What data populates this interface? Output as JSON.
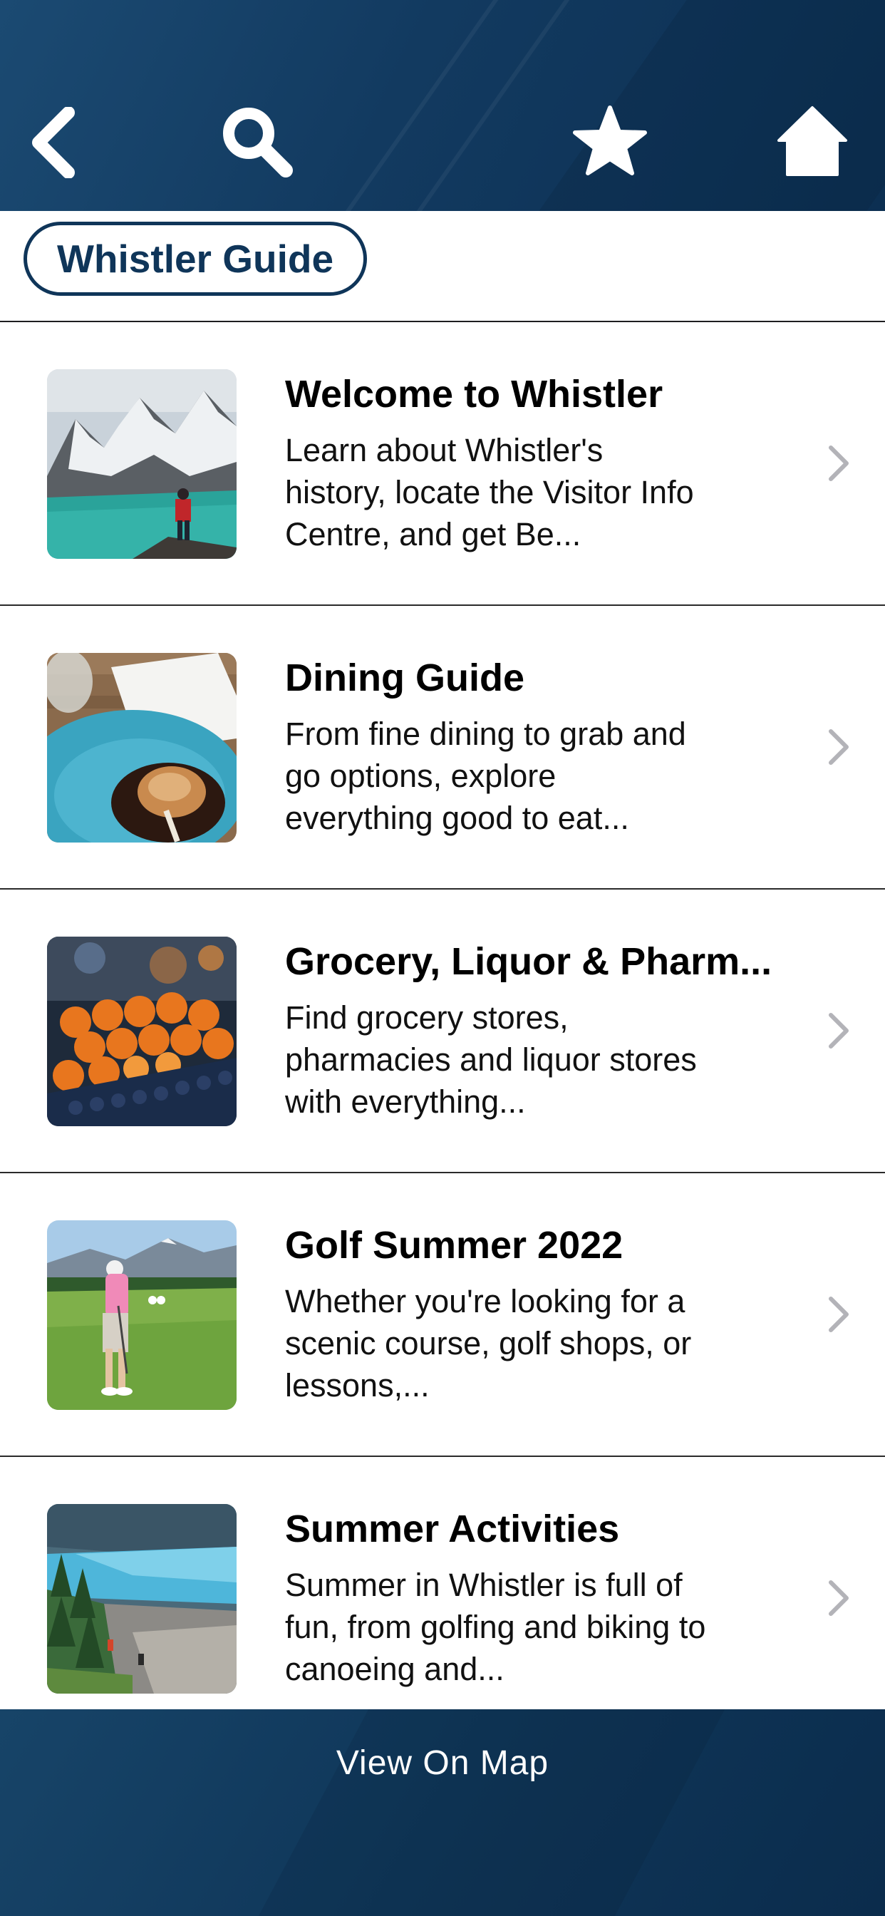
{
  "nav": {
    "back_icon": "chevron-left-icon",
    "search_icon": "search-icon",
    "favorite_icon": "star-icon",
    "home_icon": "home-icon",
    "bar_color": "#123a60"
  },
  "header": {
    "title": "Whistler Guide",
    "accent_color": "#0f3559"
  },
  "list": {
    "items": [
      {
        "title": "Welcome to Whistler",
        "description": "Learn about Whistler's history, locate the Visitor Info Centre, and get Be...",
        "thumbnail": "mountain-lake-hiker-photo"
      },
      {
        "title": "Dining Guide",
        "description": "From fine dining to grab and go options, explore everything good to eat...",
        "thumbnail": "plated-meal-photo"
      },
      {
        "title": "Grocery, Liquor & Pharm...",
        "description": "Find grocery stores, pharmacies and liquor stores with everything...",
        "thumbnail": "produce-fruit-photo"
      },
      {
        "title": "Golf Summer 2022",
        "description": "Whether you're looking for a scenic course, golf shops, or lessons,...",
        "thumbnail": "golfer-on-course-photo"
      },
      {
        "title": "Summer Activities",
        "description": "Summer in Whistler is full of fun, from golfing and biking to canoeing and...",
        "thumbnail": "alpine-lake-hikers-photo"
      }
    ]
  },
  "footer": {
    "map_label": "View On Map"
  }
}
